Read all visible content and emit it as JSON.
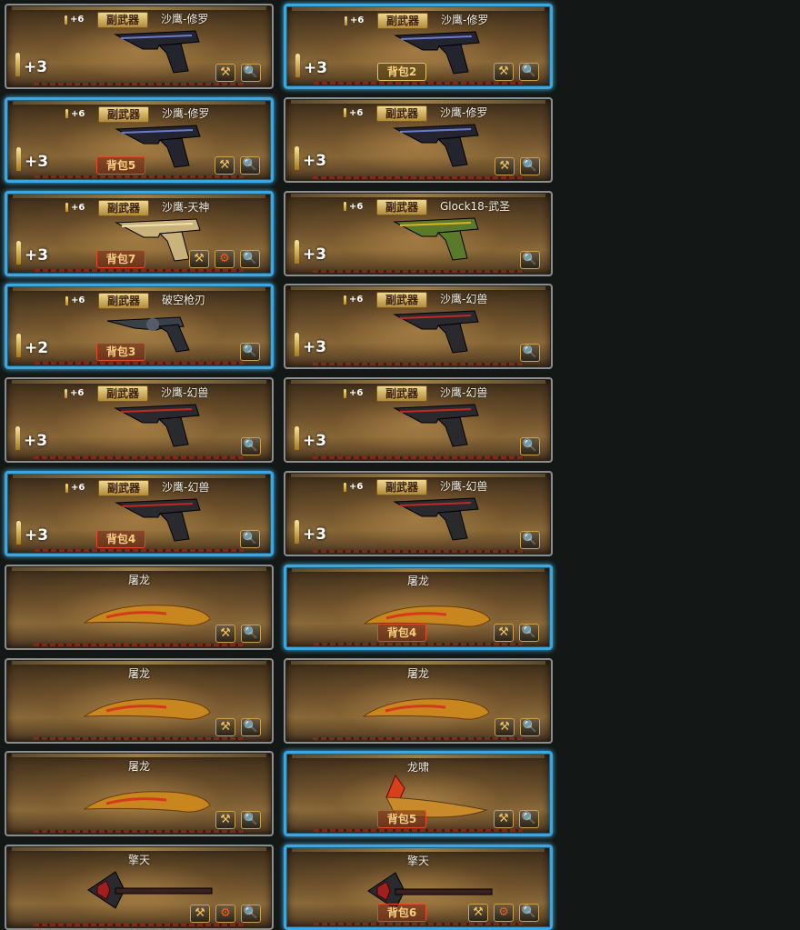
{
  "labels": {
    "ammo": "+6",
    "type": "副武器",
    "bag_prefix": "背包"
  },
  "icons": {
    "tools": "tools-icon",
    "gear": "gear-icon",
    "magnify": "magnifier-icon",
    "bullet": "bullet-icon"
  },
  "colors": {
    "selected_border": "#3aa7e0",
    "bag_border": "#e24a2a",
    "badge": "#d9b45a"
  },
  "cards": [
    {
      "name": "沙鹰-修罗",
      "enh": "+3",
      "bag": "",
      "selected": false,
      "weapon": "pistol-dark",
      "btns": [
        "tools",
        "magnify"
      ],
      "type": true
    },
    {
      "name": "沙鹰-修罗",
      "enh": "+3",
      "bag": "2",
      "bagGold": true,
      "selected": true,
      "weapon": "pistol-dark",
      "btns": [
        "tools",
        "magnify"
      ],
      "type": true
    },
    {
      "name": "沙鹰-修罗",
      "enh": "+3",
      "bag": "5",
      "selected": true,
      "weapon": "pistol-dark",
      "btns": [
        "tools",
        "magnify"
      ],
      "type": true
    },
    {
      "name": "沙鹰-修罗",
      "enh": "+3",
      "bag": "",
      "selected": false,
      "weapon": "pistol-dark",
      "btns": [
        "tools",
        "magnify"
      ],
      "type": true
    },
    {
      "name": "沙鹰-天神",
      "enh": "+3",
      "bag": "7",
      "selected": true,
      "weapon": "pistol-gold",
      "btns": [
        "tools",
        "gear",
        "magnify"
      ],
      "type": true
    },
    {
      "name": "Glock18-武圣",
      "enh": "+3",
      "bag": "",
      "selected": false,
      "weapon": "pistol-green",
      "btns": [
        "magnify"
      ],
      "type": true
    },
    {
      "name": "破空枪刃",
      "enh": "+2",
      "bag": "3",
      "selected": true,
      "weapon": "revolver",
      "btns": [
        "magnify"
      ],
      "type": true
    },
    {
      "name": "沙鹰-幻兽",
      "enh": "+3",
      "bag": "",
      "selected": false,
      "weapon": "pistol-red",
      "btns": [
        "magnify"
      ],
      "type": true
    },
    {
      "name": "沙鹰-幻兽",
      "enh": "+3",
      "bag": "",
      "selected": false,
      "weapon": "pistol-red",
      "btns": [
        "magnify"
      ],
      "type": true
    },
    {
      "name": "沙鹰-幻兽",
      "enh": "+3",
      "bag": "",
      "selected": false,
      "weapon": "pistol-red",
      "btns": [
        "magnify"
      ],
      "type": true
    },
    {
      "name": "沙鹰-幻兽",
      "enh": "+3",
      "bag": "4",
      "selected": true,
      "weapon": "pistol-red",
      "btns": [
        "magnify"
      ],
      "type": true
    },
    {
      "name": "沙鹰-幻兽",
      "enh": "+3",
      "bag": "",
      "selected": false,
      "weapon": "pistol-red",
      "btns": [
        "magnify"
      ],
      "type": true
    },
    {
      "name": "屠龙",
      "enh": "",
      "bag": "",
      "selected": false,
      "weapon": "knife",
      "btns": [
        "tools",
        "magnify"
      ],
      "type": false
    },
    {
      "name": "屠龙",
      "enh": "",
      "bag": "4",
      "selected": true,
      "weapon": "knife",
      "btns": [
        "tools",
        "magnify"
      ],
      "type": false
    },
    {
      "name": "屠龙",
      "enh": "",
      "bag": "",
      "selected": false,
      "weapon": "knife",
      "btns": [
        "tools",
        "magnify"
      ],
      "type": false
    },
    {
      "name": "屠龙",
      "enh": "",
      "bag": "",
      "selected": false,
      "weapon": "knife",
      "btns": [
        "tools",
        "magnify"
      ],
      "type": false
    },
    {
      "name": "屠龙",
      "enh": "",
      "bag": "",
      "selected": false,
      "weapon": "knife",
      "btns": [
        "tools",
        "magnify"
      ],
      "type": false
    },
    {
      "name": "龙啸",
      "enh": "",
      "bag": "5",
      "selected": true,
      "weapon": "dragon-blade",
      "btns": [
        "tools",
        "magnify"
      ],
      "type": false
    },
    {
      "name": "擎天",
      "enh": "",
      "bag": "",
      "selected": false,
      "weapon": "axe",
      "btns": [
        "tools",
        "gear",
        "magnify"
      ],
      "type": false
    },
    {
      "name": "擎天",
      "enh": "",
      "bag": "6",
      "selected": true,
      "weapon": "axe",
      "btns": [
        "tools",
        "gear",
        "magnify"
      ],
      "type": false
    }
  ]
}
